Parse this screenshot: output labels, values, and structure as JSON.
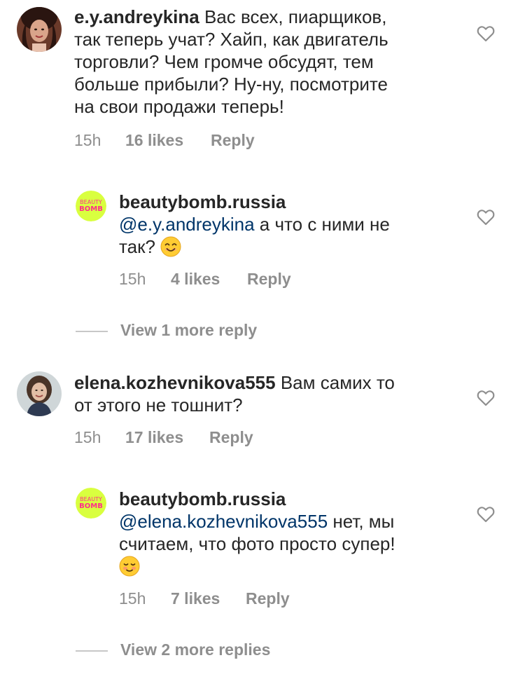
{
  "comments": [
    {
      "username": "e.y.andreykina",
      "text_lines": [
        " Вас всех, пиарщиков,",
        "так теперь учат? Хайп, как двигатель",
        "торговли? Чем громче обсудят, тем",
        "больше прибыли? Ну-ну, посмотрите",
        "на свои продажи теперь!"
      ],
      "time": "15h",
      "likes": "16 likes",
      "reply": "Reply"
    },
    {
      "username": "beautybomb.russia",
      "mention": "@e.y.andreykina",
      "text_after_mention": " а что с ними не",
      "text_line2": "так? ",
      "emoji_icon": "smiling-face-icon",
      "time": "15h",
      "likes": "4 likes",
      "reply": "Reply"
    },
    {
      "username": "elena.kozhevnikova555",
      "text_line1": " Вам самих то",
      "text_line2": "от этого не тошнит?",
      "time": "15h",
      "likes": "17 likes",
      "reply": "Reply"
    },
    {
      "username": "beautybomb.russia",
      "mention": "@elena.kozhevnikova555",
      "text_after_mention": " нет, мы",
      "text_line2": "считаем, что фото просто супер!",
      "emoji_icon": "blushing-smile-icon",
      "time": "15h",
      "likes": "7 likes",
      "reply": "Reply"
    }
  ],
  "view_more_1": "View 1 more reply",
  "view_more_2": "View 2 more replies",
  "brand_avatar": {
    "line1": "BEAUTY",
    "line2": "BOMB",
    "bg_color": "#d9ff3f",
    "text_color": "#ff2d8a"
  },
  "colors": {
    "text": "#262626",
    "secondary": "#8e8e8e",
    "mention": "#003569"
  }
}
